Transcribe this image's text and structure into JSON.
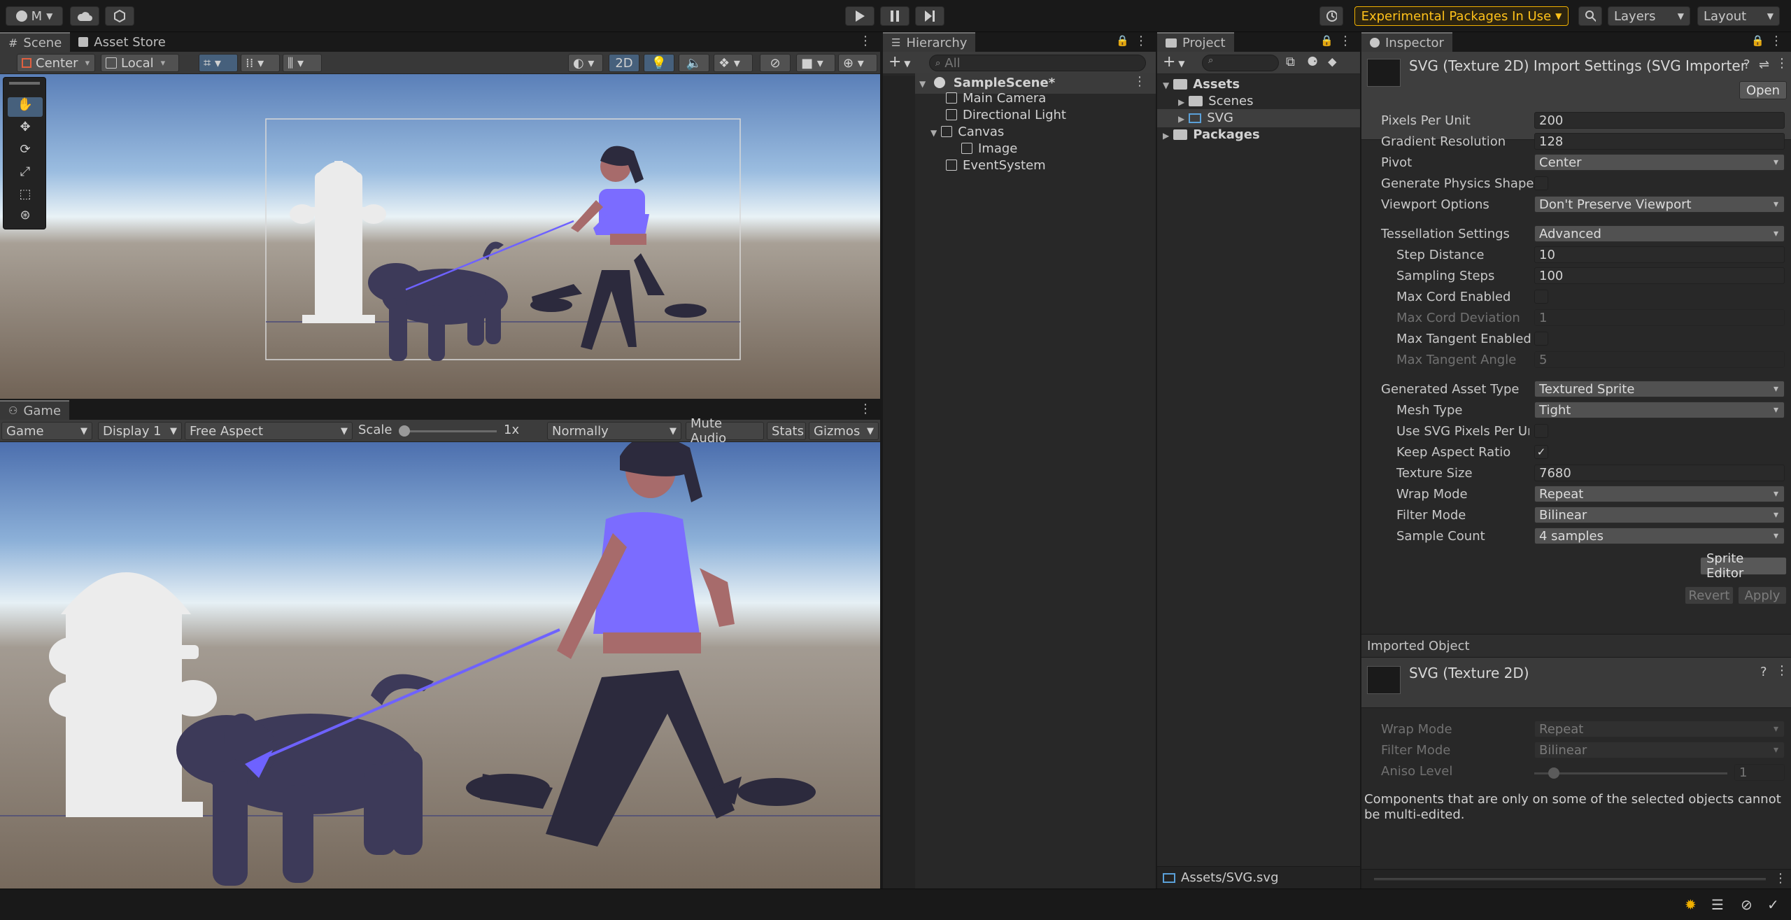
{
  "toolbar": {
    "account_label": "M",
    "experimental_label": "Experimental Packages In Use",
    "layers_label": "Layers",
    "layout_label": "Layout"
  },
  "scene_panel": {
    "tabs": [
      "Scene",
      "Asset Store"
    ],
    "pivot_mode": "Center",
    "pivot_rotation": "Local",
    "mode_2d": "2D"
  },
  "game_panel": {
    "tab": "Game",
    "view": "Game",
    "display": "Display 1",
    "aspect": "Free Aspect",
    "scale_label": "Scale",
    "scale_value": "1x",
    "scale_fraction": 0.0,
    "play_focus": "Normally",
    "mute_label": "Mute Audio",
    "stats_label": "Stats",
    "gizmos_label": "Gizmos"
  },
  "hierarchy": {
    "title": "Hierarchy",
    "search_placeholder": "All",
    "scene": "SampleScene*",
    "items": [
      "Main Camera",
      "Directional Light",
      "Canvas",
      "Image",
      "EventSystem"
    ]
  },
  "project": {
    "title": "Project",
    "assets": "Assets",
    "scenes": "Scenes",
    "svg": "SVG",
    "packages": "Packages",
    "footer_path": "Assets/SVG.svg"
  },
  "inspector": {
    "title": "Inspector",
    "header": "SVG (Texture 2D) Import Settings (SVG Importer",
    "open_label": "Open",
    "fields": {
      "pixels_per_unit": {
        "label": "Pixels Per Unit",
        "value": "200"
      },
      "gradient_resolution": {
        "label": "Gradient Resolution",
        "value": "128"
      },
      "pivot": {
        "label": "Pivot",
        "value": "Center"
      },
      "generate_physics": {
        "label": "Generate Physics Shape"
      },
      "viewport_options": {
        "label": "Viewport Options",
        "value": "Don't Preserve Viewport"
      },
      "tessellation": {
        "label": "Tessellation Settings",
        "value": "Advanced"
      },
      "step_distance": {
        "label": "Step Distance",
        "value": "10"
      },
      "sampling_steps": {
        "label": "Sampling Steps",
        "value": "100"
      },
      "max_cord_enabled": {
        "label": "Max Cord Enabled"
      },
      "max_cord_deviation": {
        "label": "Max Cord Deviation",
        "value": "1"
      },
      "max_tangent_enabled": {
        "label": "Max Tangent Enabled"
      },
      "max_tangent_angle": {
        "label": "Max Tangent Angle",
        "value": "5"
      },
      "asset_type": {
        "label": "Generated Asset Type",
        "value": "Textured Sprite"
      },
      "mesh_type": {
        "label": "Mesh Type",
        "value": "Tight"
      },
      "use_svg_ppu": {
        "label": "Use SVG Pixels Per Ur"
      },
      "keep_aspect": {
        "label": "Keep Aspect Ratio",
        "value": "✓"
      },
      "texture_size": {
        "label": "Texture Size",
        "value": "7680"
      },
      "wrap_mode": {
        "label": "Wrap Mode",
        "value": "Repeat"
      },
      "filter_mode": {
        "label": "Filter Mode",
        "value": "Bilinear"
      },
      "sample_count": {
        "label": "Sample Count",
        "value": "4 samples"
      }
    },
    "sprite_editor_label": "Sprite Editor",
    "revert_label": "Revert",
    "apply_label": "Apply",
    "imported_title": "Imported Object",
    "imported_name": "SVG (Texture 2D)",
    "imported_fields": {
      "wrap_mode": {
        "label": "Wrap Mode",
        "value": "Repeat"
      },
      "filter_mode": {
        "label": "Filter Mode",
        "value": "Bilinear"
      },
      "aniso_level": {
        "label": "Aniso Level",
        "value": "1"
      }
    },
    "aniso_fraction": 0.1,
    "multi_edit_note": "Components that are only on some of the selected objects cannot be multi-edited."
  },
  "colors": {
    "accent_blue": "#46607c",
    "warning": "#f0b000",
    "shirt": "#7b6cff",
    "dog": "#3d3a59"
  },
  "icons": [
    "play-icon",
    "pause-icon",
    "step-icon",
    "cloud-icon",
    "history-icon",
    "search-icon",
    "lock-icon",
    "kebab-icon",
    "gamepad-icon",
    "folder-icon",
    "cube-icon",
    "unity-icon"
  ]
}
